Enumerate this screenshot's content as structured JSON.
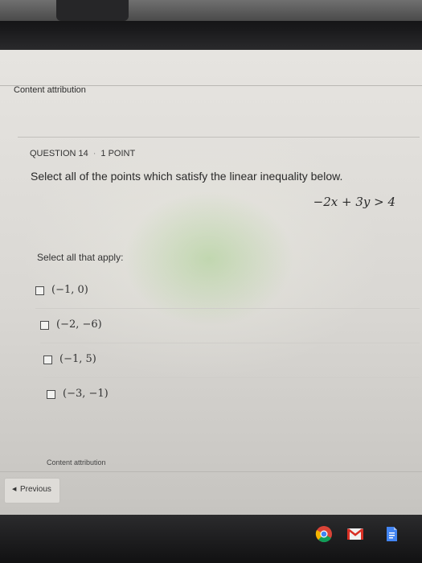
{
  "page": {
    "top_attribution": "Content attribution",
    "bottom_attribution": "Content attribution"
  },
  "question": {
    "number_label": "QUESTION 14",
    "points_label": "1 POINT",
    "prompt": "Select all of the points which satisfy the linear inequality below.",
    "inequality": "−2x + 3y > 4",
    "instruction": "Select all that apply:"
  },
  "options": [
    {
      "label": "(−1, 0)",
      "checked": false
    },
    {
      "label": "(−2, −6)",
      "checked": false
    },
    {
      "label": "(−1, 5)",
      "checked": false
    },
    {
      "label": "(−3, −1)",
      "checked": false
    }
  ],
  "nav": {
    "previous_label": "Previous"
  },
  "shelf": {
    "icons": [
      "chrome-icon",
      "gmail-icon",
      "docs-icon"
    ]
  }
}
